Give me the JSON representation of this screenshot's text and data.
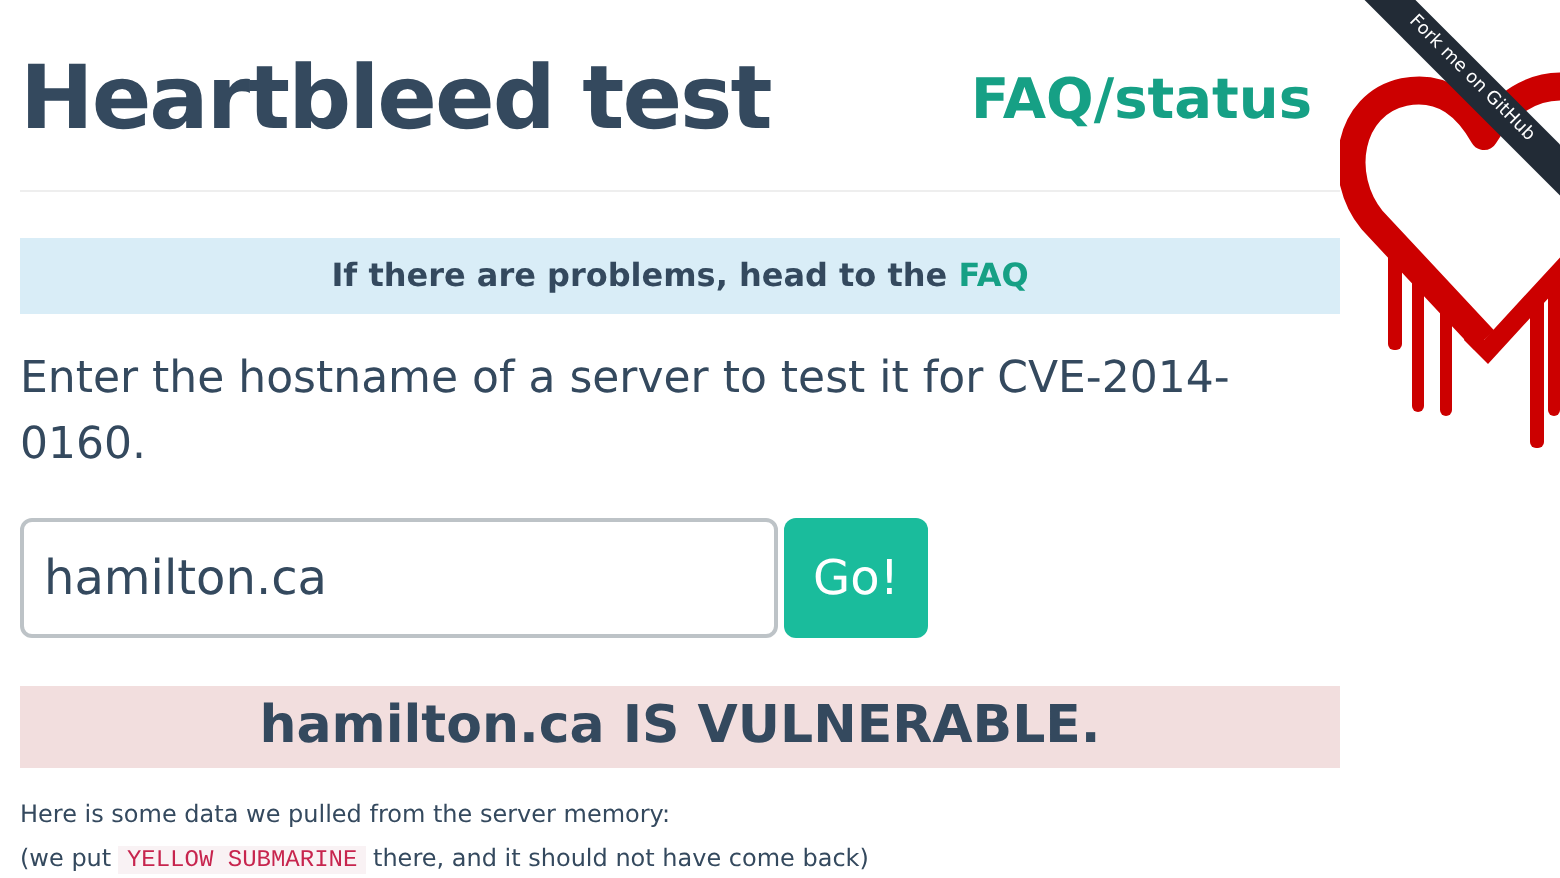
{
  "title": "Heartbleed test",
  "nav_link": "FAQ/status",
  "ribbon": "Fork me on GitHub",
  "info_alert": {
    "text": "If there are problems, head to the",
    "link": "FAQ"
  },
  "prompt": "Enter the hostname of a server to test it for CVE-2014-0160.",
  "host_field": {
    "value": "hamilton.ca"
  },
  "go_button": "Go!",
  "result_alert": "hamilton.ca IS VULNERABLE.",
  "memory_note": "Here is some data we pulled from the server memory:",
  "note": {
    "before": "(we put",
    "code": "YELLOW SUBMARINE",
    "after": "there, and it should not have come back)"
  }
}
